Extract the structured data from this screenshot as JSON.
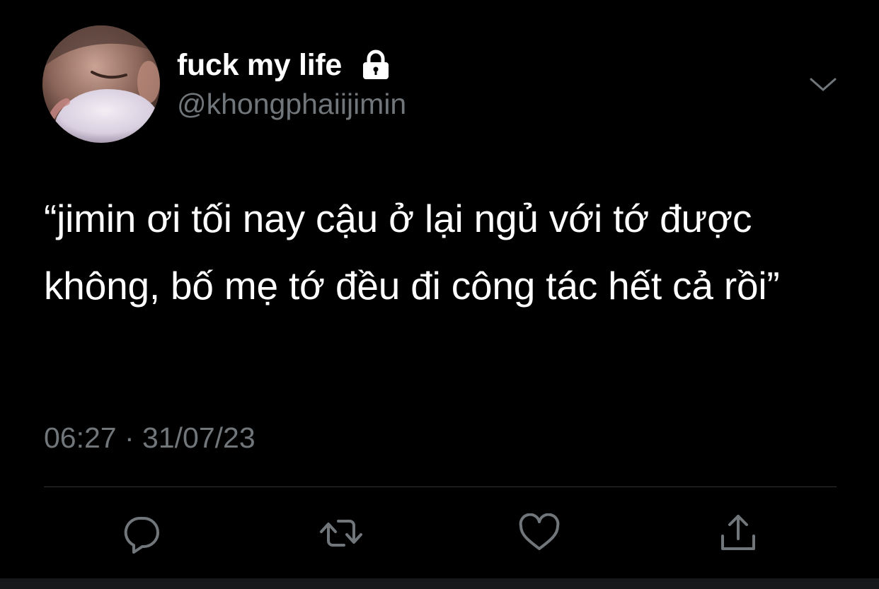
{
  "user": {
    "display_name": "fuck my life",
    "handle": "@khongphaiijimin",
    "protected_icon": "lock-icon",
    "avatar": "profile-photo"
  },
  "tweet": {
    "text": "“jimin ơi tối nay cậu ở lại ngủ với tớ được không, bố mẹ tớ đều đi công tác hết cả rồi”",
    "timestamp": "06:27 · 31/07/23"
  },
  "actions": [
    {
      "name": "reply",
      "icon": "reply-icon"
    },
    {
      "name": "retweet",
      "icon": "retweet-icon"
    },
    {
      "name": "like",
      "icon": "heart-icon"
    },
    {
      "name": "share",
      "icon": "share-icon"
    }
  ],
  "menu": {
    "icon": "chevron-down-icon"
  },
  "colors": {
    "background": "#000000",
    "primary_text": "#ffffff",
    "secondary_text": "#71767b",
    "divider": "#2f3336"
  }
}
